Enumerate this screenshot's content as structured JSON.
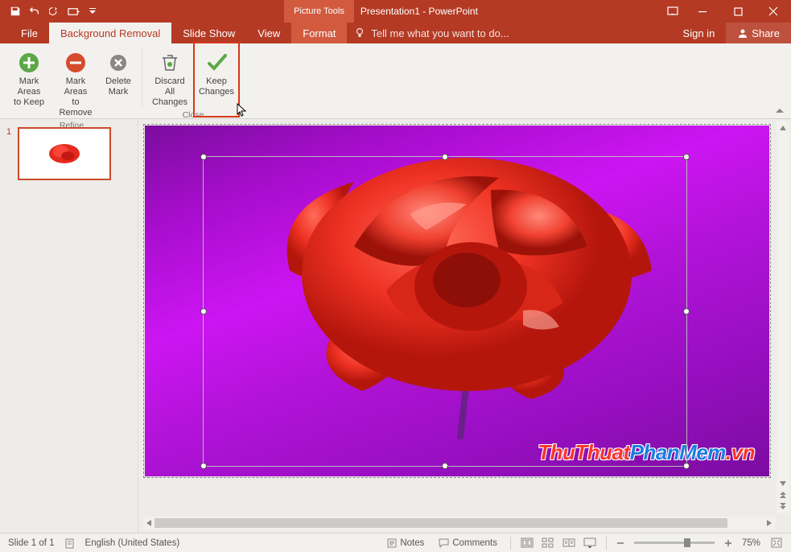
{
  "titlebar": {
    "contextual_tab": "Picture Tools",
    "app_title": "Presentation1 - PowerPoint"
  },
  "tabs": {
    "file": "File",
    "bgremoval": "Background Removal",
    "slideshow": "Slide Show",
    "view": "View",
    "format": "Format",
    "tell_me": "Tell me what you want to do...",
    "sign_in": "Sign in",
    "share": "Share"
  },
  "ribbon": {
    "mark_keep_l1": "Mark Areas",
    "mark_keep_l2": "to Keep",
    "mark_remove_l1": "Mark Areas",
    "mark_remove_l2": "to Remove",
    "delete_l1": "Delete",
    "delete_l2": "Mark",
    "group_refine": "Refine",
    "discard_l1": "Discard All",
    "discard_l2": "Changes",
    "keep_l1": "Keep",
    "keep_l2": "Changes",
    "group_close": "Close"
  },
  "thumbs": {
    "n1": "1"
  },
  "watermark": {
    "p1": "ThuThuat",
    "p2": "PhanMem",
    "p3": ".vn"
  },
  "statusbar": {
    "slide_info": "Slide 1 of 1",
    "language": "English (United States)",
    "notes": "Notes",
    "comments": "Comments",
    "zoom_pct": "75%"
  }
}
